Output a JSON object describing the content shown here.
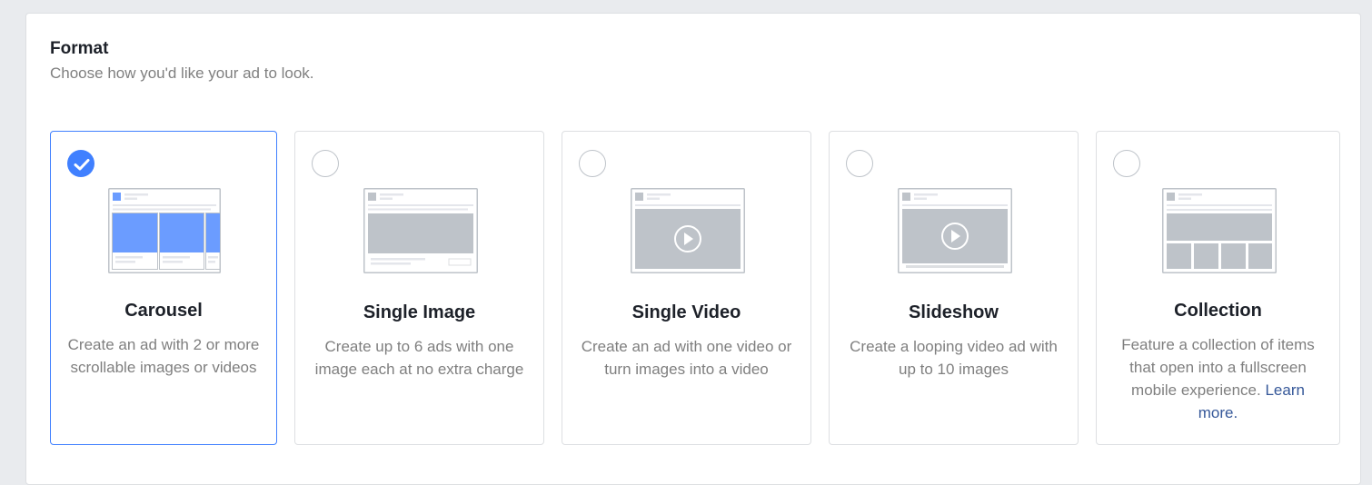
{
  "header": {
    "title": "Format",
    "subtitle": "Choose how you'd like your ad to look."
  },
  "options": [
    {
      "id": "carousel",
      "label": "Carousel",
      "description": "Create an ad with 2 or more scrollable images or videos",
      "selected": true,
      "icon": "carousel-preview-icon"
    },
    {
      "id": "single-image",
      "label": "Single Image",
      "description": "Create up to 6 ads with one image each at no extra charge",
      "selected": false,
      "icon": "single-image-preview-icon"
    },
    {
      "id": "single-video",
      "label": "Single Video",
      "description": "Create an ad with one video or turn images into a video",
      "selected": false,
      "icon": "single-video-preview-icon"
    },
    {
      "id": "slideshow",
      "label": "Slideshow",
      "description": "Create a looping video ad with up to 10 images",
      "selected": false,
      "icon": "slideshow-preview-icon"
    },
    {
      "id": "collection",
      "label": "Collection",
      "description": "Feature a collection of items that open into a fullscreen mobile experience.",
      "link": "Learn more.",
      "selected": false,
      "icon": "collection-preview-icon"
    }
  ],
  "colors": {
    "accent": "#4080ff",
    "link": "#365899",
    "text": "#1d2129",
    "muted": "#7f7f7f"
  }
}
